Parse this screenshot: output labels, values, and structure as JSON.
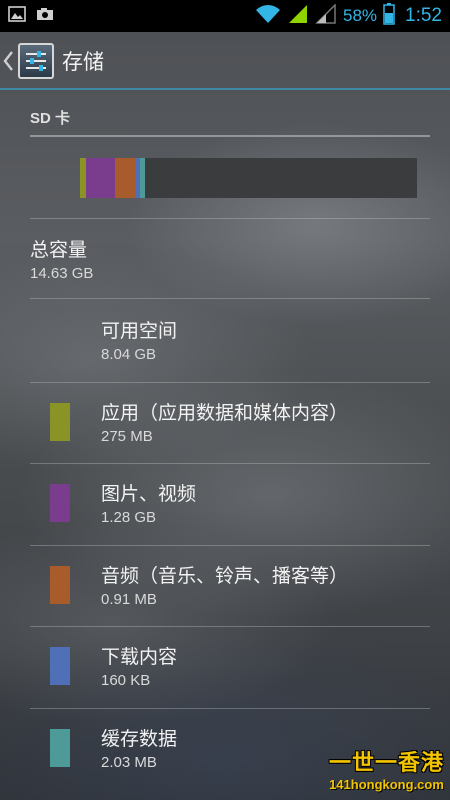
{
  "status_bar": {
    "battery_percent": "58%",
    "time": "1:52",
    "icons": [
      "image-icon",
      "camera-icon",
      "wifi-icon",
      "signal-icon",
      "signal-weak-icon",
      "battery-icon"
    ],
    "accent_color": "#33b5e5"
  },
  "action_bar": {
    "title": "存储"
  },
  "storage": {
    "section_title": "SD 卡",
    "usage_bar": [
      {
        "name": "应用（应用数据和媒体内容）",
        "color": "#8a9426",
        "fraction": 0.0188
      },
      {
        "name": "图片、视频",
        "color": "#7a3c8c",
        "fraction": 0.0875
      },
      {
        "name": "音频（音乐、铃声、播客等）",
        "color": "#a85c2c",
        "fraction": 0.0622
      },
      {
        "name": "下载内容",
        "color": "#4f6fb6",
        "fraction": 0.0106
      },
      {
        "name": "缓存数据",
        "color": "#4d9a98",
        "fraction": 0.0139
      }
    ],
    "total_label": "总容量",
    "total_value": "14.63 GB",
    "items": [
      {
        "label": "可用空间",
        "value": "8.04 GB",
        "color": ""
      },
      {
        "label": "应用（应用数据和媒体内容）",
        "value": "275 MB",
        "color": "#8a9426"
      },
      {
        "label": "图片、视频",
        "value": "1.28 GB",
        "color": "#7a3c8c"
      },
      {
        "label": "音频（音乐、铃声、播客等）",
        "value": "0.91 MB",
        "color": "#a85c2c"
      },
      {
        "label": "下载内容",
        "value": "160 KB",
        "color": "#4f6fb6"
      },
      {
        "label": "缓存数据",
        "value": "2.03 MB",
        "color": "#4d9a98"
      }
    ]
  },
  "watermark": {
    "line1": "一世一香港",
    "line2": "141hongkong.com"
  }
}
